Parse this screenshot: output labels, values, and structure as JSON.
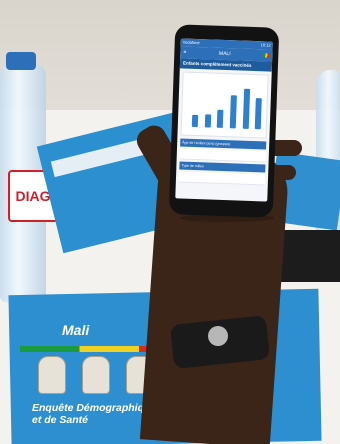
{
  "phone": {
    "status_left": "Vodafone",
    "status_time": "16:12",
    "app_title": "MALI",
    "screen_title": "Enfants complètement vaccinés",
    "row1": "Âge de l'enfant (ans) (groupes)",
    "row2": "Type de milieu",
    "chart_values": [
      0.28,
      0.3,
      0.4,
      0.75,
      0.92,
      0.7
    ],
    "bar_color": "#2d7fd0"
  },
  "bottle_label": "DIAG",
  "book": {
    "title": "Mali",
    "subtitle_line1": "Enquête Démographique",
    "subtitle_line2": "et de Santé"
  }
}
